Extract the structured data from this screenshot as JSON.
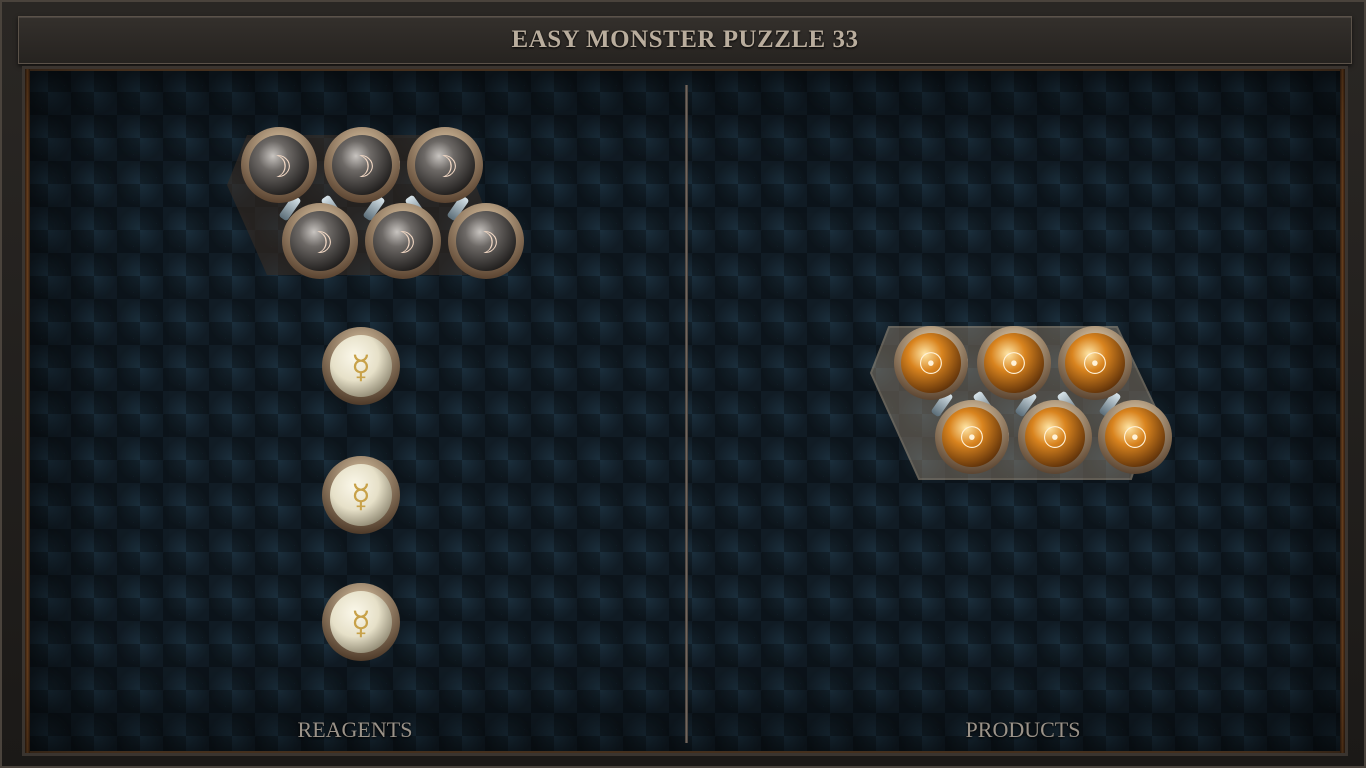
{
  "window": {
    "title": "EASY MONSTER PUZZLE 33"
  },
  "panels": {
    "reagents_label": "REAGENTS",
    "products_label": "PRODUCTS"
  },
  "glyphs": {
    "silver": "☽",
    "quicksilver": "☿",
    "gold": "☉"
  },
  "reagents": [
    {
      "name": "silver-molecule",
      "atoms": [
        "silver",
        "silver",
        "silver",
        "silver",
        "silver",
        "silver"
      ]
    },
    {
      "name": "quicksilver-atom-1",
      "atoms": [
        "quicksilver"
      ]
    },
    {
      "name": "quicksilver-atom-2",
      "atoms": [
        "quicksilver"
      ]
    },
    {
      "name": "quicksilver-atom-3",
      "atoms": [
        "quicksilver"
      ]
    }
  ],
  "products": [
    {
      "name": "gold-molecule",
      "atoms": [
        "gold",
        "gold",
        "gold",
        "gold",
        "gold",
        "gold"
      ]
    }
  ],
  "colors": {
    "silver_atom": "#6d6966",
    "quicksilver_atom": "#e6e0c8",
    "gold_atom": "#d9841f",
    "bond": "#9fb2bd",
    "ring": "#8a6a4a"
  }
}
